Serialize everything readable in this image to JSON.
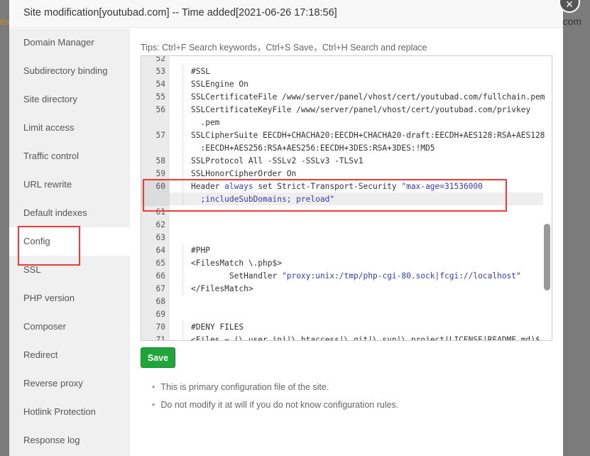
{
  "background": {
    "left_text": "ex",
    "right_text": "com"
  },
  "modal": {
    "title": "Site modification[youtubad.com] -- Time added[2021-06-26 17:18:56]",
    "close_icon": "close-icon"
  },
  "sidebar": {
    "active": "Config",
    "items": [
      "Domain Manager",
      "Subdirectory binding",
      "Site directory",
      "Limit access",
      "Traffic control",
      "URL rewrite",
      "Default indexes",
      "Config",
      "SSL",
      "PHP version",
      "Composer",
      "Redirect",
      "Reverse proxy",
      "Hotlink Protection",
      "Response log"
    ]
  },
  "tips": "Tips: Ctrl+F Search keywords，Ctrl+S Save，Ctrl+H Search and replace",
  "editor": {
    "current_line": "60",
    "lines": [
      {
        "n": "52",
        "t": ""
      },
      {
        "n": "53",
        "t": "#SSL"
      },
      {
        "n": "54",
        "t": "SSLEngine On"
      },
      {
        "n": "55",
        "t": "SSLCertificateFile /www/server/panel/vhost/cert/youtubad.com/fullchain.pem"
      },
      {
        "n": "56",
        "t": "SSLCertificateKeyFile /www/server/panel/vhost/cert/youtubad.com/privkey",
        "w": "  .pem"
      },
      {
        "n": "57",
        "t": "SSLCipherSuite EECDH+CHACHA20:EECDH+CHACHA20-draft:EECDH+AES128:RSA+AES128",
        "w": "  :EECDH+AES256:RSA+AES256:EECDH+3DES:RSA+3DES:!MD5"
      },
      {
        "n": "58",
        "t": "SSLProtocol All -SSLv2 -SSLv3 -TLSv1"
      },
      {
        "n": "59",
        "t": "SSLHonorCipherOrder On"
      },
      {
        "n": "60",
        "t": "Header always set Strict-Transport-Security \"max-age=31536000",
        "w": "  ;includeSubDomains; preload\""
      },
      {
        "n": "61",
        "t": ""
      },
      {
        "n": "62",
        "t": ""
      },
      {
        "n": "63",
        "t": ""
      },
      {
        "n": "64",
        "t": "#PHP"
      },
      {
        "n": "65",
        "t": "<FilesMatch \\.php$>"
      },
      {
        "n": "66",
        "t": "        SetHandler \"proxy:unix:/tmp/php-cgi-80.sock|fcgi://localhost\""
      },
      {
        "n": "67",
        "t": "</FilesMatch>"
      },
      {
        "n": "68",
        "t": ""
      },
      {
        "n": "69",
        "t": ""
      },
      {
        "n": "70",
        "t": "#DENY FILES"
      },
      {
        "n": "71",
        "t": "<Files ~ (\\.user.ini|\\.htaccess|\\.git|\\.svn|\\.project|LICENSE|README.md)$"
      }
    ]
  },
  "save_label": "Save",
  "notes": [
    "This is primary configuration file of the site.",
    "Do not modify it at will if you do not know configuration rules."
  ],
  "colors": {
    "save": "#20a53a",
    "highlight": "#f03a3a",
    "keyword": "#3344cc"
  }
}
